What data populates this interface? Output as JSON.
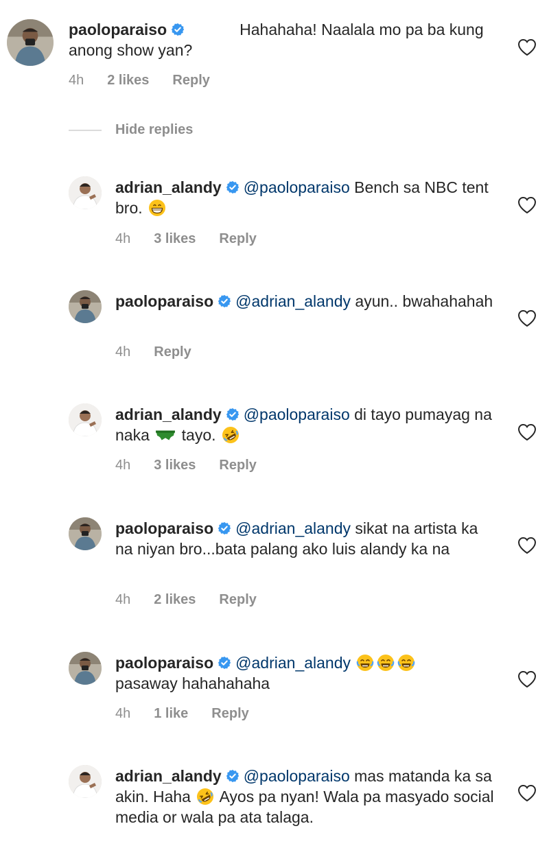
{
  "top_comment": {
    "username": "paoloparaiso",
    "text": "Hahahaha! Naalala mo pa ba kung anong show yan?",
    "time": "4h",
    "likes": "2 likes",
    "reply": "Reply"
  },
  "hide_replies_label": "Hide replies",
  "replies": [
    {
      "username": "adrian_alandy",
      "mention": "@paoloparaiso",
      "text_a": "Bench sa NBC tent bro.",
      "time": "4h",
      "likes": "3 likes",
      "reply": "Reply"
    },
    {
      "username": "paoloparaiso",
      "mention": "@adrian_alandy",
      "text_a": "ayun.. bwahahahah",
      "time": "4h",
      "reply": "Reply"
    },
    {
      "username": "adrian_alandy",
      "mention": "@paoloparaiso",
      "text_a": "di tayo pumayag na naka",
      "text_b": "tayo.",
      "time": "4h",
      "likes": "3 likes",
      "reply": "Reply"
    },
    {
      "username": "paoloparaiso",
      "mention": "@adrian_alandy",
      "text_a": "sikat na artista ka na niyan bro...bata palang ako luis alandy ka na",
      "time": "4h",
      "likes": "2 likes",
      "reply": "Reply"
    },
    {
      "username": "paoloparaiso",
      "mention": "@adrian_alandy",
      "text_a": "pasaway hahahahaha",
      "time": "4h",
      "likes": "1 like",
      "reply": "Reply"
    },
    {
      "username": "adrian_alandy",
      "mention": "@paoloparaiso",
      "text_a": "mas matanda ka sa akin. Haha",
      "text_b": "Ayos pa nyan! Wala pa masyado social media or wala pa ata talaga."
    }
  ],
  "icons": {
    "verified": "verified-badge-icon",
    "heart": "heart-outline-icon",
    "emoji_grin": "grinning-face-icon",
    "emoji_rofl": "rolling-on-floor-laughing-icon",
    "emoji_joy": "face-with-tears-of-joy-icon",
    "emoji_swim": "green-swim-briefs-icon"
  },
  "colors": {
    "mention": "#00376b",
    "verified": "#3897f0",
    "meta": "#8e8e8e"
  }
}
